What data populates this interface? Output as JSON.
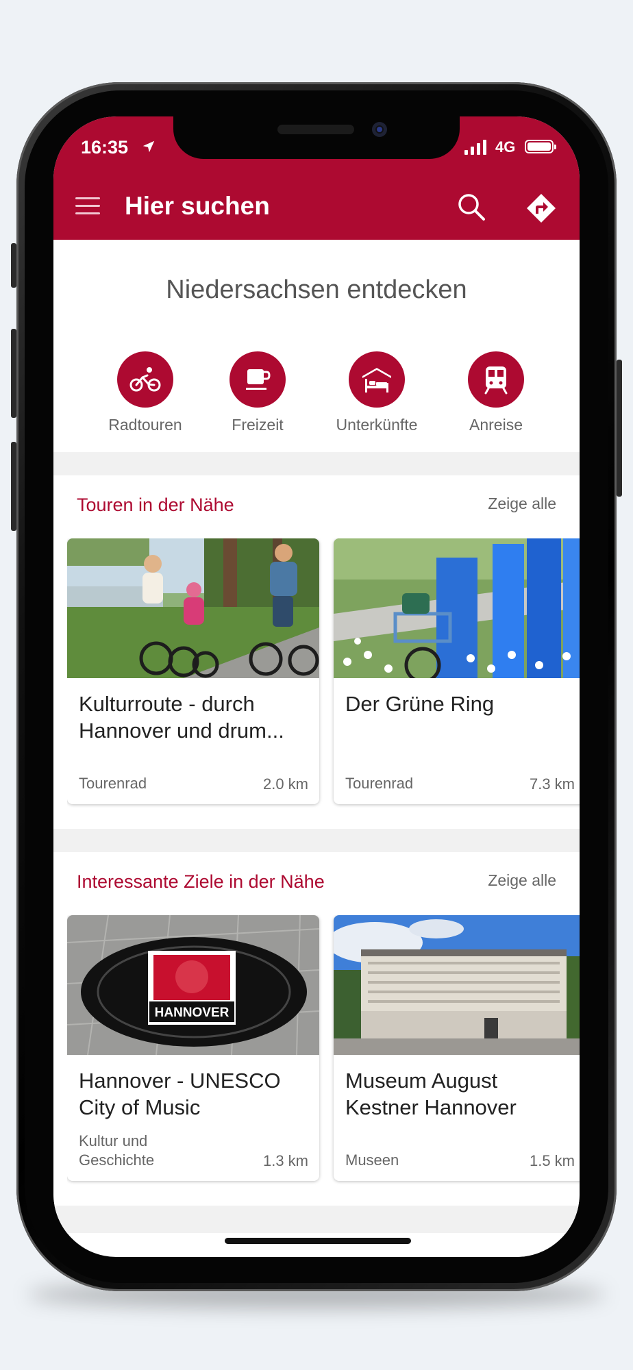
{
  "status_bar": {
    "time": "16:35",
    "network": "4G"
  },
  "app_bar": {
    "title": "Hier suchen"
  },
  "discover": {
    "heading": "Niedersachsen entdecken",
    "categories": [
      {
        "label": "Radtouren",
        "icon": "bicycle-icon"
      },
      {
        "label": "Freizeit",
        "icon": "coffee-cup-icon"
      },
      {
        "label": "Unterkünfte",
        "icon": "bed-icon"
      },
      {
        "label": "Anreise",
        "icon": "train-icon"
      }
    ]
  },
  "tours_section": {
    "title": "Touren in der Nähe",
    "see_all": "Zeige alle",
    "cards": [
      {
        "title": "Kulturroute - durch Hannover und drum...",
        "category": "Tourenrad",
        "distance": "2.0 km"
      },
      {
        "title": "Der Grüne Ring",
        "category": "Tourenrad",
        "distance": "7.3 km"
      }
    ]
  },
  "places_section": {
    "title": "Interessante Ziele in der Nähe",
    "see_all": "Zeige alle",
    "cards": [
      {
        "title": "Hannover - UNESCO City of Music",
        "category": "Kultur und Geschichte",
        "distance": "1.3 km",
        "image_text": "HANNOVER"
      },
      {
        "title": "Museum August Kestner Hannover",
        "category": "Museen",
        "distance": "1.5 km"
      }
    ]
  },
  "colors": {
    "brand": "#ad0a31",
    "background": "#eef2f6"
  }
}
